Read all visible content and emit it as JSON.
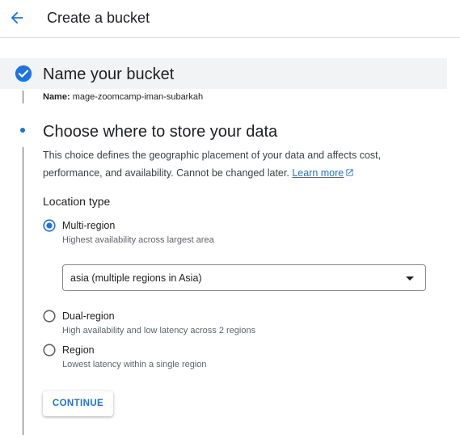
{
  "header": {
    "title": "Create a bucket",
    "back_icon": "arrow-back-icon"
  },
  "colors": {
    "accent": "#1a73e8",
    "text": "#202124",
    "muted": "#5f6368"
  },
  "step1": {
    "title": "Name your bucket",
    "name_label": "Name:",
    "name_value": "mage-zoomcamp-iman-subarkah",
    "status_icon": "check-circle-icon"
  },
  "step2": {
    "title": "Choose where to store your data",
    "description": "This choice defines the geographic placement of your data and affects cost, performance, and availability. Cannot be changed later.",
    "learn_more": "Learn more",
    "location_type_label": "Location type",
    "options": [
      {
        "label": "Multi-region",
        "sub": "Highest availability across largest area",
        "selected": true
      },
      {
        "label": "Dual-region",
        "sub": "High availability and low latency across 2 regions",
        "selected": false
      },
      {
        "label": "Region",
        "sub": "Lowest latency within a single region",
        "selected": false
      }
    ],
    "multi_region_select": {
      "value": "asia (multiple regions in Asia)"
    },
    "continue_label": "CONTINUE"
  }
}
